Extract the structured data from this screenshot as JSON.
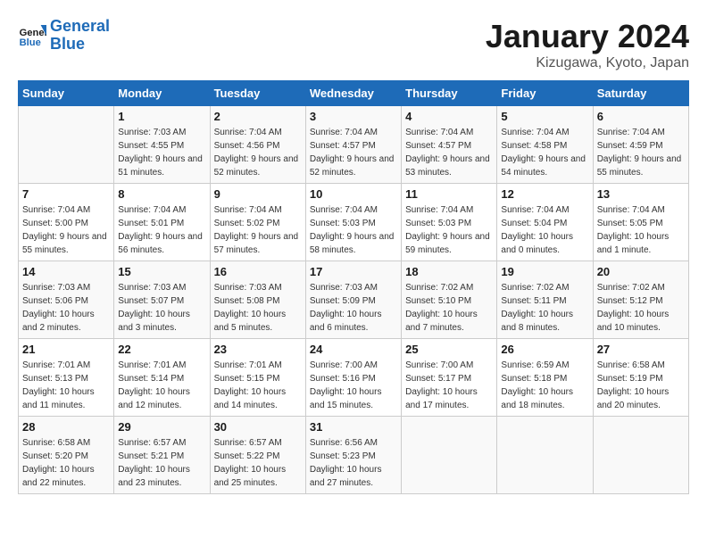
{
  "header": {
    "logo": {
      "line1": "General",
      "line2": "Blue"
    },
    "title": "January 2024",
    "location": "Kizugawa, Kyoto, Japan"
  },
  "days_of_week": [
    "Sunday",
    "Monday",
    "Tuesday",
    "Wednesday",
    "Thursday",
    "Friday",
    "Saturday"
  ],
  "weeks": [
    [
      {
        "day": "",
        "sunrise": "",
        "sunset": "",
        "daylight": ""
      },
      {
        "day": "1",
        "sunrise": "Sunrise: 7:03 AM",
        "sunset": "Sunset: 4:55 PM",
        "daylight": "Daylight: 9 hours and 51 minutes."
      },
      {
        "day": "2",
        "sunrise": "Sunrise: 7:04 AM",
        "sunset": "Sunset: 4:56 PM",
        "daylight": "Daylight: 9 hours and 52 minutes."
      },
      {
        "day": "3",
        "sunrise": "Sunrise: 7:04 AM",
        "sunset": "Sunset: 4:57 PM",
        "daylight": "Daylight: 9 hours and 52 minutes."
      },
      {
        "day": "4",
        "sunrise": "Sunrise: 7:04 AM",
        "sunset": "Sunset: 4:57 PM",
        "daylight": "Daylight: 9 hours and 53 minutes."
      },
      {
        "day": "5",
        "sunrise": "Sunrise: 7:04 AM",
        "sunset": "Sunset: 4:58 PM",
        "daylight": "Daylight: 9 hours and 54 minutes."
      },
      {
        "day": "6",
        "sunrise": "Sunrise: 7:04 AM",
        "sunset": "Sunset: 4:59 PM",
        "daylight": "Daylight: 9 hours and 55 minutes."
      }
    ],
    [
      {
        "day": "7",
        "sunrise": "Sunrise: 7:04 AM",
        "sunset": "Sunset: 5:00 PM",
        "daylight": "Daylight: 9 hours and 55 minutes."
      },
      {
        "day": "8",
        "sunrise": "Sunrise: 7:04 AM",
        "sunset": "Sunset: 5:01 PM",
        "daylight": "Daylight: 9 hours and 56 minutes."
      },
      {
        "day": "9",
        "sunrise": "Sunrise: 7:04 AM",
        "sunset": "Sunset: 5:02 PM",
        "daylight": "Daylight: 9 hours and 57 minutes."
      },
      {
        "day": "10",
        "sunrise": "Sunrise: 7:04 AM",
        "sunset": "Sunset: 5:03 PM",
        "daylight": "Daylight: 9 hours and 58 minutes."
      },
      {
        "day": "11",
        "sunrise": "Sunrise: 7:04 AM",
        "sunset": "Sunset: 5:03 PM",
        "daylight": "Daylight: 9 hours and 59 minutes."
      },
      {
        "day": "12",
        "sunrise": "Sunrise: 7:04 AM",
        "sunset": "Sunset: 5:04 PM",
        "daylight": "Daylight: 10 hours and 0 minutes."
      },
      {
        "day": "13",
        "sunrise": "Sunrise: 7:04 AM",
        "sunset": "Sunset: 5:05 PM",
        "daylight": "Daylight: 10 hours and 1 minute."
      }
    ],
    [
      {
        "day": "14",
        "sunrise": "Sunrise: 7:03 AM",
        "sunset": "Sunset: 5:06 PM",
        "daylight": "Daylight: 10 hours and 2 minutes."
      },
      {
        "day": "15",
        "sunrise": "Sunrise: 7:03 AM",
        "sunset": "Sunset: 5:07 PM",
        "daylight": "Daylight: 10 hours and 3 minutes."
      },
      {
        "day": "16",
        "sunrise": "Sunrise: 7:03 AM",
        "sunset": "Sunset: 5:08 PM",
        "daylight": "Daylight: 10 hours and 5 minutes."
      },
      {
        "day": "17",
        "sunrise": "Sunrise: 7:03 AM",
        "sunset": "Sunset: 5:09 PM",
        "daylight": "Daylight: 10 hours and 6 minutes."
      },
      {
        "day": "18",
        "sunrise": "Sunrise: 7:02 AM",
        "sunset": "Sunset: 5:10 PM",
        "daylight": "Daylight: 10 hours and 7 minutes."
      },
      {
        "day": "19",
        "sunrise": "Sunrise: 7:02 AM",
        "sunset": "Sunset: 5:11 PM",
        "daylight": "Daylight: 10 hours and 8 minutes."
      },
      {
        "day": "20",
        "sunrise": "Sunrise: 7:02 AM",
        "sunset": "Sunset: 5:12 PM",
        "daylight": "Daylight: 10 hours and 10 minutes."
      }
    ],
    [
      {
        "day": "21",
        "sunrise": "Sunrise: 7:01 AM",
        "sunset": "Sunset: 5:13 PM",
        "daylight": "Daylight: 10 hours and 11 minutes."
      },
      {
        "day": "22",
        "sunrise": "Sunrise: 7:01 AM",
        "sunset": "Sunset: 5:14 PM",
        "daylight": "Daylight: 10 hours and 12 minutes."
      },
      {
        "day": "23",
        "sunrise": "Sunrise: 7:01 AM",
        "sunset": "Sunset: 5:15 PM",
        "daylight": "Daylight: 10 hours and 14 minutes."
      },
      {
        "day": "24",
        "sunrise": "Sunrise: 7:00 AM",
        "sunset": "Sunset: 5:16 PM",
        "daylight": "Daylight: 10 hours and 15 minutes."
      },
      {
        "day": "25",
        "sunrise": "Sunrise: 7:00 AM",
        "sunset": "Sunset: 5:17 PM",
        "daylight": "Daylight: 10 hours and 17 minutes."
      },
      {
        "day": "26",
        "sunrise": "Sunrise: 6:59 AM",
        "sunset": "Sunset: 5:18 PM",
        "daylight": "Daylight: 10 hours and 18 minutes."
      },
      {
        "day": "27",
        "sunrise": "Sunrise: 6:58 AM",
        "sunset": "Sunset: 5:19 PM",
        "daylight": "Daylight: 10 hours and 20 minutes."
      }
    ],
    [
      {
        "day": "28",
        "sunrise": "Sunrise: 6:58 AM",
        "sunset": "Sunset: 5:20 PM",
        "daylight": "Daylight: 10 hours and 22 minutes."
      },
      {
        "day": "29",
        "sunrise": "Sunrise: 6:57 AM",
        "sunset": "Sunset: 5:21 PM",
        "daylight": "Daylight: 10 hours and 23 minutes."
      },
      {
        "day": "30",
        "sunrise": "Sunrise: 6:57 AM",
        "sunset": "Sunset: 5:22 PM",
        "daylight": "Daylight: 10 hours and 25 minutes."
      },
      {
        "day": "31",
        "sunrise": "Sunrise: 6:56 AM",
        "sunset": "Sunset: 5:23 PM",
        "daylight": "Daylight: 10 hours and 27 minutes."
      },
      {
        "day": "",
        "sunrise": "",
        "sunset": "",
        "daylight": ""
      },
      {
        "day": "",
        "sunrise": "",
        "sunset": "",
        "daylight": ""
      },
      {
        "day": "",
        "sunrise": "",
        "sunset": "",
        "daylight": ""
      }
    ]
  ]
}
